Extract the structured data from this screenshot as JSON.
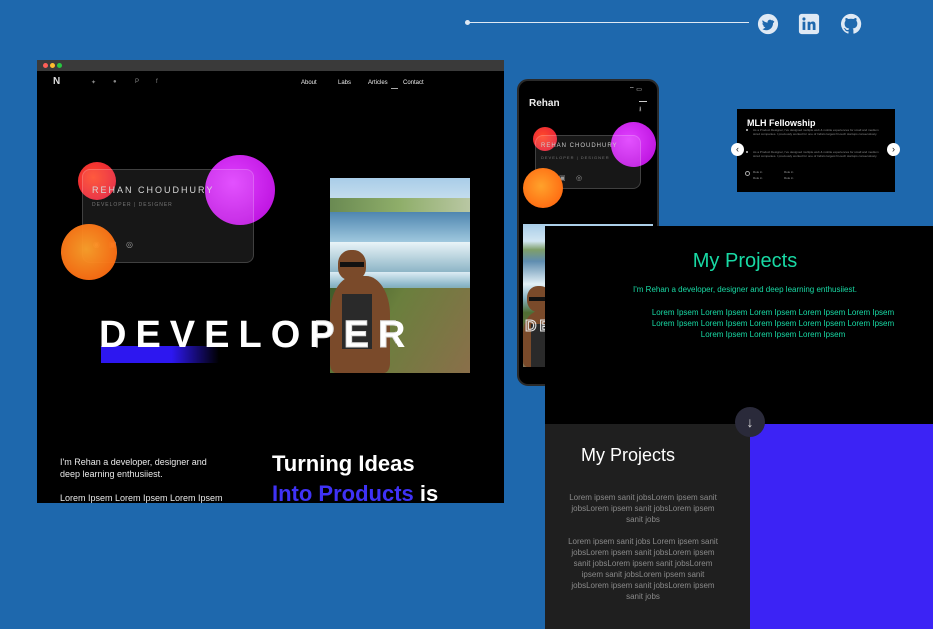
{
  "colors": {
    "background": "#1e68ad",
    "accent_green": "#18d9a4",
    "accent_blue": "#3c23f5",
    "magenta": "#cc16e6",
    "orange": "#ff7a12"
  },
  "social": {
    "icons": [
      "twitter-icon",
      "linkedin-icon",
      "github-icon"
    ]
  },
  "desktop": {
    "logo": "N",
    "social_icons": [
      "twitter-icon",
      "github-icon",
      "pinterest-icon",
      "facebook-icon"
    ],
    "nav": [
      "About",
      "Labs",
      "Articles",
      "Contact"
    ],
    "card_name": "REHAN CHOUDHURY",
    "card_role": "DEVELOPER | DESIGNER",
    "headline": "DEVELOPER",
    "intro": "I'm Rehan a developer, designer and deep learning enthusiiest.",
    "lorem": "Lorem Ipsem Lorem Ipsem Lorem Ipsem",
    "tagline1": "Turning Ideas",
    "tagline2": "Into Products",
    "tagline3": "is"
  },
  "phone": {
    "title": "Rehan",
    "card_name": "REHAN CHOUDHURY",
    "card_role": "DEVELOPER | DESIGNER",
    "headline": "DEVELOPER"
  },
  "popup": {
    "title": "MLH Fellowship",
    "bullet1": "As a Product Designer, I've designed multiple web & mobile experiences for small and medium sized companies. I previously worked for one of India's largest fin-tech startups consecutively.",
    "bullet2": "As a Product Designer, I've designed multiple web & mobile experiences for small and medium sized companies. I previously worked for one of India's largest fin-tech startups consecutively.",
    "meta": [
      "Role in",
      "Role in",
      "Role in",
      "Role in"
    ]
  },
  "projects_top": {
    "title": "My Projects",
    "subtitle": "I'm Rehan a developer, designer and deep learning enthusiiest.",
    "body": "Lorem Ipsem Lorem Ipsem Lorem Ipsem Lorem Ipsem Lorem Ipsem Lorem Ipsem Lorem Ipsem Lorem Ipsem Lorem Ipsem Lorem Ipsem Lorem Ipsem Lorem Ipsem Lorem Ipsem"
  },
  "projects_bottom": {
    "title": "My Projects",
    "para1": "Lorem ipsem sanit jobsLorem ipsem sanit jobsLorem ipsem sanit jobsLorem ipsem sanit jobs",
    "para2": "Lorem ipsem sanit jobs Lorem ipsem sanit jobsLorem ipsem sanit jobsLorem ipsem sanit jobsLorem ipsem sanit jobsLorem ipsem sanit jobsLorem ipsem sanit jobsLorem ipsem sanit jobsLorem ipsem sanit jobs"
  }
}
